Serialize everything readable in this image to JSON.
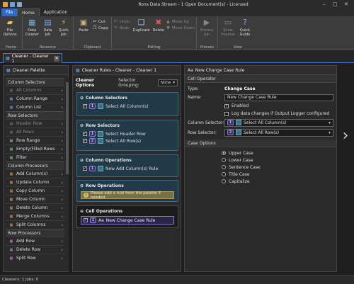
{
  "window": {
    "title": "Rons Data Stream - 1 Open Document(s) - Licensed"
  },
  "ribbon_tabs": [
    "File",
    "Home",
    "Application"
  ],
  "ribbon": {
    "home_group": {
      "label": "Home",
      "file_options": "File\nOptions"
    },
    "resource_group": {
      "label": "Resource",
      "data_cleaner": "Data\nCleaner",
      "data_job": "Data\nJob",
      "quick_job": "Quick\nJob"
    },
    "clipboard_group": {
      "label": "Clipboard",
      "paste": "Paste",
      "cut": "Cut",
      "copy": "Copy"
    },
    "editing_group": {
      "label": "Editing",
      "undo": "Undo",
      "redo": "Redo",
      "duplicate": "Duplicate",
      "delete": "Delete",
      "move_up": "Move Up",
      "move_down": "Move Down"
    },
    "process_group": {
      "label": "Process",
      "process_job": "Process\nJob"
    },
    "view_group": {
      "label": "View",
      "show_preview": "Show\nPreview",
      "quick_guide": "Quick\nGuide"
    }
  },
  "doc_tab": {
    "label": "Cleaner - Cleaner 1"
  },
  "palette": {
    "title": "Cleaner Palette",
    "sections": [
      {
        "header": "Column Selectors",
        "items": [
          {
            "label": "All Columns",
            "disabled": true
          },
          {
            "label": "Column Range",
            "disabled": false
          },
          {
            "label": "Column List",
            "disabled": false
          }
        ]
      },
      {
        "header": "Row Selectors",
        "items": [
          {
            "label": "Header Row",
            "disabled": true
          },
          {
            "label": "All Rows",
            "disabled": true
          },
          {
            "label": "Row Range",
            "disabled": false
          },
          {
            "label": "Empty/Filled Rows",
            "disabled": false
          },
          {
            "label": "Filter",
            "disabled": false
          }
        ]
      },
      {
        "header": "Column Processors",
        "items": [
          {
            "label": "Add Column(s)",
            "disabled": false
          },
          {
            "label": "Update Column",
            "disabled": false
          },
          {
            "label": "Copy Column",
            "disabled": false
          },
          {
            "label": "Move Column",
            "disabled": false
          },
          {
            "label": "Delete Column",
            "disabled": false
          },
          {
            "label": "Merge Columns",
            "disabled": false
          },
          {
            "label": "Split Columns",
            "disabled": false
          }
        ]
      },
      {
        "header": "Row Processors",
        "items": [
          {
            "label": "Add Row",
            "disabled": false
          },
          {
            "label": "Delete Row",
            "disabled": false
          },
          {
            "label": "Split Row",
            "disabled": false
          }
        ]
      }
    ]
  },
  "rules": {
    "title": "Cleaner Rules - Cleaner - Cleaner 1",
    "options_label": "Cleaner Options",
    "selector_grouping_label": "Selector Grouping:",
    "selector_grouping_value": "None",
    "column_selectors": {
      "title": "Column Selectors",
      "items": [
        {
          "num": "1",
          "label": "Select All Column(s)"
        }
      ]
    },
    "row_selectors": {
      "title": "Row Selectors",
      "items": [
        {
          "num": "1",
          "label": "Select Header Row"
        },
        {
          "num": "2",
          "label": "Select All Row(s)"
        }
      ]
    },
    "column_operations": {
      "title": "Column Operations",
      "items": [
        {
          "num": "1",
          "label": "New Add Column(s) Rule"
        }
      ]
    },
    "row_operations": {
      "title": "Row Operations",
      "warning": "Please add a rule from the palette if needed"
    },
    "cell_operations": {
      "title": "Cell Operations",
      "items": [
        {
          "num": "1",
          "prefix": "Aa",
          "label": "New Change Case Rule"
        }
      ]
    }
  },
  "detail": {
    "title_prefix": "Aa",
    "title": "New Change Case Rule",
    "cell_operator_header": "Cell Operator",
    "type_label": "Type:",
    "type_value": "Change Case",
    "name_label": "Name:",
    "name_value": "New Change Case Rule",
    "enabled_label": "Enabled",
    "log_label": "Log data changes if Output Logger configured",
    "column_selector_label": "Column Selector:",
    "column_selector_num": "1",
    "column_selector_value": "Select All Column(s)",
    "row_selector_label": "Row Selector:",
    "row_selector_num": "2",
    "row_selector_value": "Select All Row(s)",
    "case_options_header": "Case Options",
    "case_options": [
      "Upper Case",
      "Lower Case",
      "Sentence Case",
      "Title Case",
      "Capitalize"
    ],
    "selected_case": "Upper Case"
  },
  "status": {
    "text": "Cleaners: 1 Jobs: 0"
  },
  "colors": {
    "accent": "#3a7bd5",
    "file_tab": "#2d6bc4",
    "rule_box": "#223a48",
    "warning": "#7a7045",
    "selector_badge": "#8a7ad8"
  }
}
